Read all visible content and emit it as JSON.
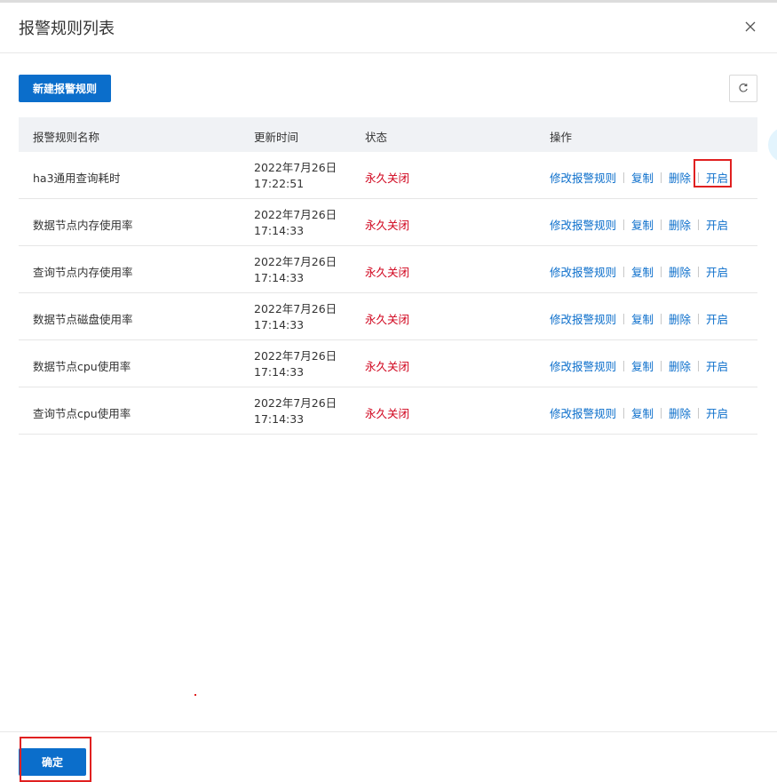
{
  "dialog": {
    "title": "报警规则列表",
    "new_button": "新建报警规则",
    "ok_button": "确定"
  },
  "table": {
    "headers": {
      "name": "报警规则名称",
      "time": "更新时间",
      "status": "状态",
      "ops": "操作"
    },
    "op_labels": {
      "edit": "修改报警规则",
      "copy": "复制",
      "delete": "删除",
      "enable": "开启"
    },
    "rows": [
      {
        "name": "ha3通用查询耗时",
        "date": "2022年7月26日",
        "time": "17:22:51",
        "status": "永久关闭"
      },
      {
        "name": "数据节点内存使用率",
        "date": "2022年7月26日",
        "time": "17:14:33",
        "status": "永久关闭"
      },
      {
        "name": "查询节点内存使用率",
        "date": "2022年7月26日",
        "time": "17:14:33",
        "status": "永久关闭"
      },
      {
        "name": "数据节点磁盘使用率",
        "date": "2022年7月26日",
        "time": "17:14:33",
        "status": "永久关闭"
      },
      {
        "name": "数据节点cpu使用率",
        "date": "2022年7月26日",
        "time": "17:14:33",
        "status": "永久关闭"
      },
      {
        "name": "查询节点cpu使用率",
        "date": "2022年7月26日",
        "time": "17:14:33",
        "status": "永久关闭"
      }
    ]
  },
  "icons": {
    "close": "close-icon",
    "refresh": "refresh-icon"
  },
  "colors": {
    "primary": "#0b6ecb",
    "status_closed": "#d0021b",
    "highlight": "#e02020"
  }
}
